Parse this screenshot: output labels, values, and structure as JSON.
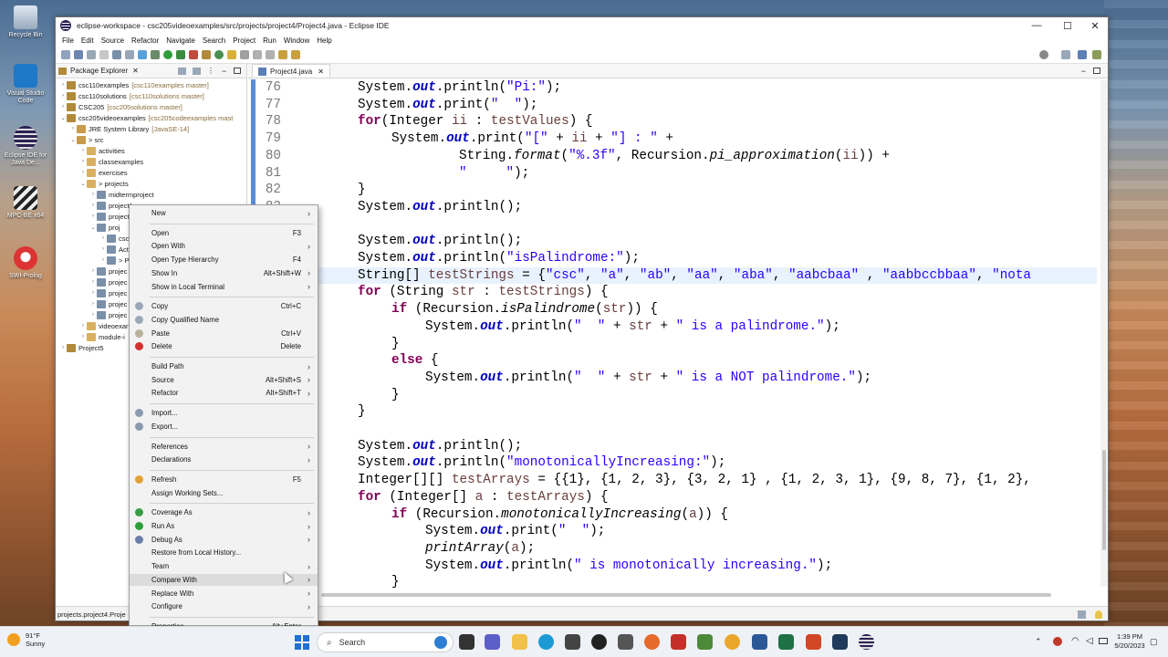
{
  "desktop": {
    "icons": [
      {
        "label": "Recycle Bin"
      },
      {
        "label": "Visual Studio Code"
      },
      {
        "label": "Eclipse IDE for Java De..."
      },
      {
        "label": "MPC-BE x64"
      },
      {
        "label": "SWI-Prolog"
      }
    ]
  },
  "window": {
    "title": "eclipse-workspace - csc205videoexamples/src/projects/project4/Project4.java - Eclipse IDE",
    "controls": {
      "minimize": "—",
      "maximize": "☐",
      "close": "✕"
    }
  },
  "menubar": [
    "File",
    "Edit",
    "Source",
    "Refactor",
    "Navigate",
    "Search",
    "Project",
    "Run",
    "Window",
    "Help"
  ],
  "package_explorer": {
    "title": "Package Explorer",
    "rows": [
      {
        "twisty": "›",
        "label": "csc110examples",
        "decor": "[csc110examples master]",
        "indent": 0
      },
      {
        "twisty": "›",
        "label": "csc110solutions",
        "decor": "[csc110solutions master]",
        "indent": 0
      },
      {
        "twisty": "›",
        "label": "CSC205",
        "decor": "[csc205solutions master]",
        "indent": 0
      },
      {
        "twisty": "⌄",
        "label": "csc205videoexamples",
        "decor": "[csc205codeexamples mast",
        "indent": 0
      },
      {
        "twisty": "›",
        "label": "JRE System Library",
        "decor": "[JavaSE-14]",
        "indent": 1
      },
      {
        "twisty": "⌄",
        "label": "> src",
        "decor": "",
        "indent": 1
      },
      {
        "twisty": "›",
        "label": "activities",
        "decor": "",
        "indent": 2
      },
      {
        "twisty": "›",
        "label": "classexamples",
        "decor": "",
        "indent": 2
      },
      {
        "twisty": "›",
        "label": "exercises",
        "decor": "",
        "indent": 2
      },
      {
        "twisty": "⌄",
        "label": "> projects",
        "decor": "",
        "indent": 2
      },
      {
        "twisty": "›",
        "label": "midtermproject",
        "decor": "",
        "indent": 3
      },
      {
        "twisty": "›",
        "label": "project1",
        "decor": "",
        "indent": 3
      },
      {
        "twisty": "›",
        "label": "project",
        "decor": "",
        "indent": 3
      },
      {
        "twisty": "⌄",
        "label": "proj",
        "decor": "",
        "indent": 3
      },
      {
        "twisty": "›",
        "label": "csc",
        "decor": "",
        "indent": 4
      },
      {
        "twisty": "›",
        "label": "Act",
        "decor": "",
        "indent": 4
      },
      {
        "twisty": "›",
        "label": "> P",
        "decor": "",
        "indent": 4
      },
      {
        "twisty": "›",
        "label": "projec",
        "decor": "",
        "indent": 3
      },
      {
        "twisty": "›",
        "label": "projec",
        "decor": "",
        "indent": 3
      },
      {
        "twisty": "›",
        "label": "projec",
        "decor": "",
        "indent": 3
      },
      {
        "twisty": "›",
        "label": "projec",
        "decor": "",
        "indent": 3
      },
      {
        "twisty": "›",
        "label": "projec",
        "decor": "",
        "indent": 3
      },
      {
        "twisty": "›",
        "label": "videoexan",
        "decor": "",
        "indent": 2
      },
      {
        "twisty": "›",
        "label": "module-i",
        "decor": "",
        "indent": 2
      },
      {
        "twisty": "›",
        "label": "Project5",
        "decor": "",
        "indent": 0
      }
    ]
  },
  "editor": {
    "tab": "Project4.java",
    "lines": [
      {
        "n": "76",
        "html": "System.<span class='fi'>out</span>.println(<span class='st'>\"Pi:\"</span>);",
        "indent": 0
      },
      {
        "n": "77",
        "html": "System.<span class='fi'>out</span>.print(<span class='st'>\"  \"</span>);",
        "indent": 0
      },
      {
        "n": "78",
        "html": "<span class='kw'>for</span>(Integer <span class='va'>ii</span> : <span class='va'>testValues</span>) {",
        "indent": 0
      },
      {
        "n": "79",
        "html": "System.<span class='fi'>out</span>.print(<span class='st'>\"[\"</span> + <span class='va'>ii</span> + <span class='st'>\"] : \"</span> +",
        "indent": 1
      },
      {
        "n": "80",
        "html": "String.<span class='it'>format</span>(<span class='st'>\"%.3f\"</span>, Recursion.<span class='it'>pi_approximation</span>(<span class='va'>ii</span>)) +",
        "indent": 3
      },
      {
        "n": "81",
        "html": "<span class='st'>\"     \"</span>);",
        "indent": 3
      },
      {
        "n": "82",
        "html": "}",
        "indent": 0
      },
      {
        "n": "83",
        "html": "System.<span class='fi'>out</span>.println();",
        "indent": 0
      },
      {
        "n": "84",
        "html": "",
        "indent": 0
      },
      {
        "n": "85",
        "html": "System.<span class='fi'>out</span>.println();",
        "indent": 0
      },
      {
        "n": "86",
        "html": "System.<span class='fi'>out</span>.println(<span class='st'>\"isPalindrome:\"</span>);",
        "indent": 0
      },
      {
        "n": "87",
        "html": "String[] <span class='va'>testStrings</span> = {<span class='st'>\"csc\"</span>, <span class='st'>\"a\"</span>, <span class='st'>\"ab\"</span>, <span class='st'>\"aa\"</span>, <span class='st'>\"aba\"</span>, <span class='st'>\"aabcbaa\"</span> , <span class='st'>\"aabbccbbaa\"</span>, <span class='st'>\"nota</span>",
        "indent": 0,
        "highlight": true
      },
      {
        "n": "88",
        "html": "<span class='kw'>for</span> (String <span class='va'>str</span> : <span class='va'>testStrings</span>) {",
        "indent": 0
      },
      {
        "n": "89",
        "html": "<span class='kw'>if</span> (Recursion.<span class='it'>isPalindrome</span>(<span class='va'>str</span>)) {",
        "indent": 1
      },
      {
        "n": "90",
        "html": "System.<span class='fi'>out</span>.println(<span class='st'>\"  \"</span> + <span class='va'>str</span> + <span class='st'>\" is a palindrome.\"</span>);",
        "indent": 2
      },
      {
        "n": "91",
        "html": "}",
        "indent": 1
      },
      {
        "n": "92",
        "html": "<span class='kw'>else</span> {",
        "indent": 1
      },
      {
        "n": "93",
        "html": "System.<span class='fi'>out</span>.println(<span class='st'>\"  \"</span> + <span class='va'>str</span> + <span class='st'>\" is a NOT palindrome.\"</span>);",
        "indent": 2
      },
      {
        "n": "94",
        "html": "}",
        "indent": 1
      },
      {
        "n": "95",
        "html": "}",
        "indent": 0
      },
      {
        "n": "96",
        "html": "",
        "indent": 0
      },
      {
        "n": "97",
        "html": "System.<span class='fi'>out</span>.println();",
        "indent": 0
      },
      {
        "n": "98",
        "html": "System.<span class='fi'>out</span>.println(<span class='st'>\"monotonicallyIncreasing:\"</span>);",
        "indent": 0
      },
      {
        "n": "99",
        "html": "Integer[][] <span class='va'>testArrays</span> = {{1}, {1, 2, 3}, {3, 2, 1} , {1, 2, 3, 1}, {9, 8, 7}, {1, 2},",
        "indent": 0
      },
      {
        "n": "100",
        "html": "<span class='kw'>for</span> (Integer[] <span class='va'>a</span> : <span class='va'>testArrays</span>) {",
        "indent": 0
      },
      {
        "n": "101",
        "html": "<span class='kw'>if</span> (Recursion.<span class='it'>monotonicallyIncreasing</span>(<span class='va'>a</span>)) {",
        "indent": 1
      },
      {
        "n": "102",
        "html": "System.<span class='fi'>out</span>.print(<span class='st'>\"  \"</span>);",
        "indent": 2
      },
      {
        "n": "103",
        "html": "<span class='it'>printArray</span>(<span class='va'>a</span>);",
        "indent": 2
      },
      {
        "n": "104",
        "html": "System.<span class='fi'>out</span>.println(<span class='st'>\" is monotonically increasing.\"</span>);",
        "indent": 2
      },
      {
        "n": "105",
        "html": "}",
        "indent": 1
      }
    ]
  },
  "status_bar": {
    "text": "projects.project4.Proje"
  },
  "context_menu": {
    "items": [
      {
        "label": "New",
        "shortcut": "",
        "submenu": true
      },
      {
        "sep": true
      },
      {
        "label": "Open",
        "shortcut": "F3"
      },
      {
        "label": "Open With",
        "shortcut": "",
        "submenu": true
      },
      {
        "label": "Open Type Hierarchy",
        "shortcut": "F4"
      },
      {
        "label": "Show In",
        "shortcut": "Alt+Shift+W",
        "submenu": true
      },
      {
        "label": "Show in Local Terminal",
        "shortcut": "",
        "submenu": true
      },
      {
        "sep": true
      },
      {
        "label": "Copy",
        "shortcut": "Ctrl+C",
        "icon": "#9aa7b8"
      },
      {
        "label": "Copy Qualified Name",
        "shortcut": "",
        "icon": "#9aa7b8"
      },
      {
        "label": "Paste",
        "shortcut": "Ctrl+V",
        "icon": "#b8b09a"
      },
      {
        "label": "Delete",
        "shortcut": "Delete",
        "icon": "#d23030"
      },
      {
        "sep": true
      },
      {
        "label": "Build Path",
        "shortcut": "",
        "submenu": true
      },
      {
        "label": "Source",
        "shortcut": "Alt+Shift+S",
        "submenu": true
      },
      {
        "label": "Refactor",
        "shortcut": "Alt+Shift+T",
        "submenu": true
      },
      {
        "sep": true
      },
      {
        "label": "Import...",
        "shortcut": "",
        "icon": "#8a9bb0"
      },
      {
        "label": "Export...",
        "shortcut": "",
        "icon": "#8a9bb0"
      },
      {
        "sep": true
      },
      {
        "label": "References",
        "shortcut": "",
        "submenu": true
      },
      {
        "label": "Declarations",
        "shortcut": "",
        "submenu": true
      },
      {
        "sep": true
      },
      {
        "label": "Refresh",
        "shortcut": "F5",
        "icon": "#e2a23a"
      },
      {
        "label": "Assign Working Sets...",
        "shortcut": ""
      },
      {
        "sep": true
      },
      {
        "label": "Coverage As",
        "shortcut": "",
        "submenu": true,
        "icon": "#3a9b45"
      },
      {
        "label": "Run As",
        "shortcut": "",
        "submenu": true,
        "icon": "#2f9e3a"
      },
      {
        "label": "Debug As",
        "shortcut": "",
        "submenu": true,
        "icon": "#6b7fa8"
      },
      {
        "label": "Restore from Local History...",
        "shortcut": ""
      },
      {
        "label": "Team",
        "shortcut": "",
        "submenu": true
      },
      {
        "label": "Compare With",
        "shortcut": "",
        "submenu": true,
        "selected": true
      },
      {
        "label": "Replace With",
        "shortcut": "",
        "submenu": true
      },
      {
        "label": "Configure",
        "shortcut": "",
        "submenu": true
      },
      {
        "sep": true
      },
      {
        "label": "Properties",
        "shortcut": "Alt+Enter"
      }
    ]
  },
  "taskbar": {
    "weather_temp": "91°F",
    "weather_desc": "Sunny",
    "search_placeholder": "Search",
    "time": "1:39 PM",
    "date": "5/20/2023"
  }
}
